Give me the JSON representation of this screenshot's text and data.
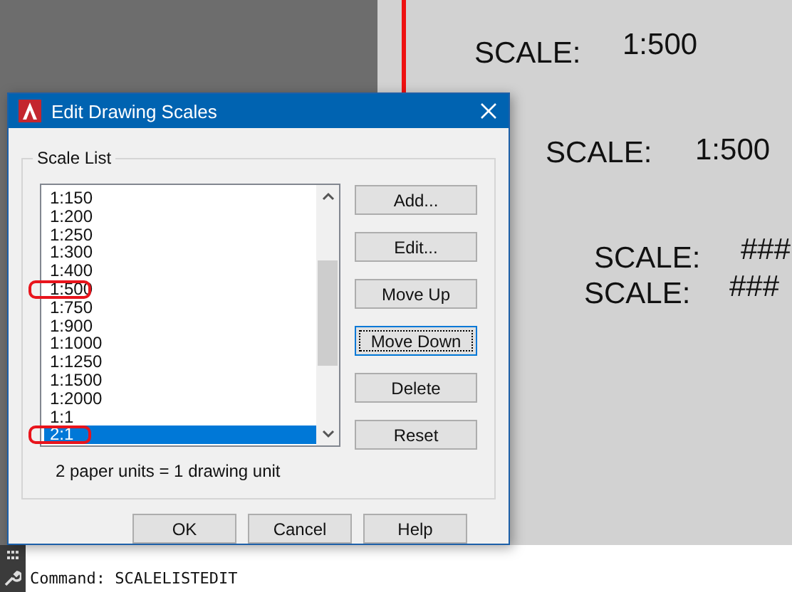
{
  "canvas_labels": [
    {
      "label": "SCALE:",
      "value": "1:500"
    },
    {
      "label": "SCALE:",
      "value": "1:500"
    },
    {
      "label": "SCALE:",
      "value": "###"
    },
    {
      "label": "SCALE:",
      "value": "###"
    }
  ],
  "dialog": {
    "title": "Edit Drawing Scales",
    "group_title": "Scale List",
    "scales": [
      {
        "label": "1:150",
        "selected": false
      },
      {
        "label": "1:200",
        "selected": false
      },
      {
        "label": "1:250",
        "selected": false
      },
      {
        "label": "1:300",
        "selected": false
      },
      {
        "label": "1:400",
        "selected": false
      },
      {
        "label": "1:500",
        "selected": false,
        "circled": true
      },
      {
        "label": "1:750",
        "selected": false
      },
      {
        "label": "1:900",
        "selected": false
      },
      {
        "label": "1:1000",
        "selected": false
      },
      {
        "label": "1:1250",
        "selected": false
      },
      {
        "label": "1:1500",
        "selected": false
      },
      {
        "label": "1:2000",
        "selected": false
      },
      {
        "label": "1:1",
        "selected": false
      },
      {
        "label": "2:1",
        "selected": true,
        "circled": true
      }
    ],
    "side_buttons": [
      {
        "label": "Add...",
        "focused": false
      },
      {
        "label": "Edit...",
        "focused": false
      },
      {
        "label": "Move Up",
        "focused": false
      },
      {
        "label": "Move Down",
        "focused": true
      },
      {
        "label": "Delete",
        "focused": false
      },
      {
        "label": "Reset",
        "focused": false
      }
    ],
    "caption": "2 paper units = 1 drawing unit",
    "bottom_buttons": [
      {
        "label": "OK"
      },
      {
        "label": "Cancel"
      },
      {
        "label": "Help"
      }
    ]
  },
  "command_line": "Command: SCALELISTEDIT"
}
